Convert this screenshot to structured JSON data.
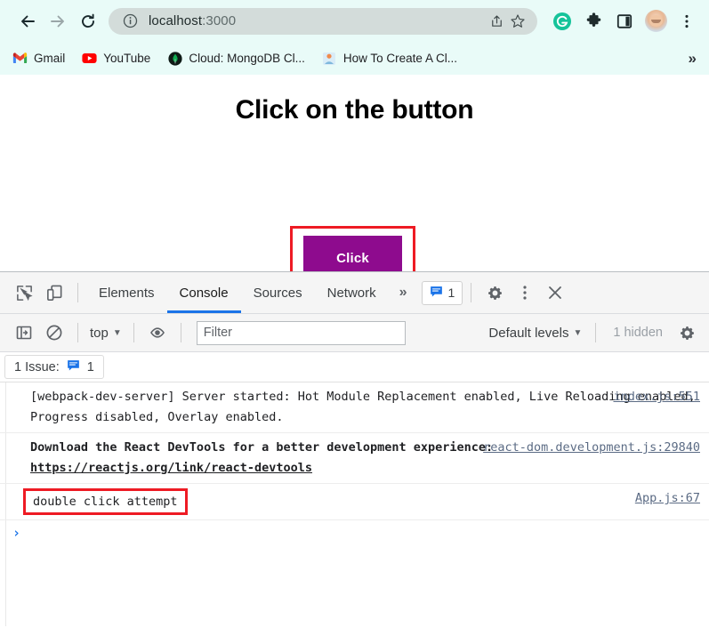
{
  "browser": {
    "nav": {
      "back_icon": "arrow-left-icon",
      "forward_icon": "arrow-right-icon",
      "reload_icon": "reload-icon"
    },
    "omnibox": {
      "info_icon": "site-info-icon",
      "url_host": "localhost",
      "url_port": ":3000",
      "share_icon": "share-icon",
      "bookmark_icon": "star-icon"
    },
    "toolbar_icons": [
      {
        "name": "grammarly-extension-icon",
        "label": "G"
      },
      {
        "name": "extensions-puzzle-icon",
        "label": ""
      },
      {
        "name": "side-panel-icon",
        "label": ""
      },
      {
        "name": "profile-avatar",
        "label": ""
      },
      {
        "name": "chrome-menu-icon",
        "label": ""
      }
    ],
    "bookmarks": [
      {
        "label": "Gmail",
        "icon": "gmail-icon"
      },
      {
        "label": "YouTube",
        "icon": "youtube-icon"
      },
      {
        "label": "Cloud: MongoDB Cl...",
        "icon": "mongodb-icon"
      },
      {
        "label": "How To Create A Cl...",
        "icon": "article-icon"
      }
    ],
    "bookmarks_overflow": "»"
  },
  "page": {
    "heading": "Click on the button",
    "button_label": "Click",
    "button_color": "#8e0b8e",
    "annotation_color": "#ee1b24"
  },
  "devtools": {
    "left_icons": [
      {
        "name": "inspect-element-icon"
      },
      {
        "name": "device-toolbar-icon"
      }
    ],
    "tabs": [
      {
        "label": "Elements",
        "active": false
      },
      {
        "label": "Console",
        "active": true
      },
      {
        "label": "Sources",
        "active": false
      },
      {
        "label": "Network",
        "active": false
      }
    ],
    "tabs_overflow": "»",
    "issues_badge": {
      "icon": "issue-message-icon",
      "count": "1"
    },
    "settings_icon": "gear-icon",
    "more_icon": "kebab-menu-icon",
    "close_icon": "close-icon",
    "console_toolbar": {
      "sidebar_toggle_icon": "console-sidebar-icon",
      "clear_icon": "clear-console-icon",
      "context": "top",
      "context_caret": "▼",
      "eye_icon": "live-expression-icon",
      "filter_placeholder": "Filter",
      "filter_value": "",
      "levels_label": "Default levels",
      "levels_caret": "▼",
      "hidden_label": "1 hidden",
      "settings_icon": "console-settings-gear-icon"
    },
    "issues_strip": {
      "label": "1 Issue:",
      "icon": "issue-message-icon",
      "count": "1"
    },
    "messages": [
      {
        "text": "[webpack-dev-server] Server started: Hot Module Replacement enabled, Live Reloading enabled, Progress disabled, Overlay enabled.",
        "source": "index.js:551",
        "bold": false,
        "annotated": false,
        "link_text": ""
      },
      {
        "text": "Download the React DevTools for a better development experience: ",
        "link_text": "https://reactjs.org/link/react-devtools",
        "source": "react-dom.development.js:29840",
        "bold": true,
        "annotated": false
      },
      {
        "text": "double click attempt",
        "source": "App.js:67",
        "bold": false,
        "annotated": true,
        "link_text": ""
      }
    ],
    "prompt_caret": "›"
  }
}
